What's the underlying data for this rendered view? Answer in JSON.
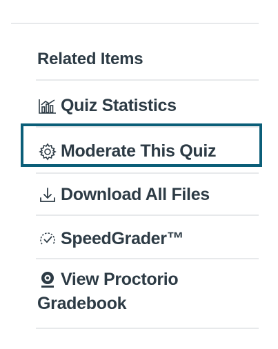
{
  "related": {
    "heading": "Related Items",
    "items": [
      {
        "label": "Quiz Statistics",
        "icon": "bar-chart-icon"
      },
      {
        "label": "Moderate This Quiz",
        "icon": "gear-icon"
      },
      {
        "label": "Download All Files",
        "icon": "download-icon"
      },
      {
        "label": "SpeedGrader™",
        "icon": "speedgrader-icon"
      },
      {
        "label_line1": "View Proctorio",
        "label_line2": "Gradebook",
        "icon": "proctorio-webcam-icon"
      }
    ]
  },
  "colors": {
    "text": "#2d3b45",
    "divider": "#e7e9eb",
    "focus_outline": "#0b5e78"
  }
}
